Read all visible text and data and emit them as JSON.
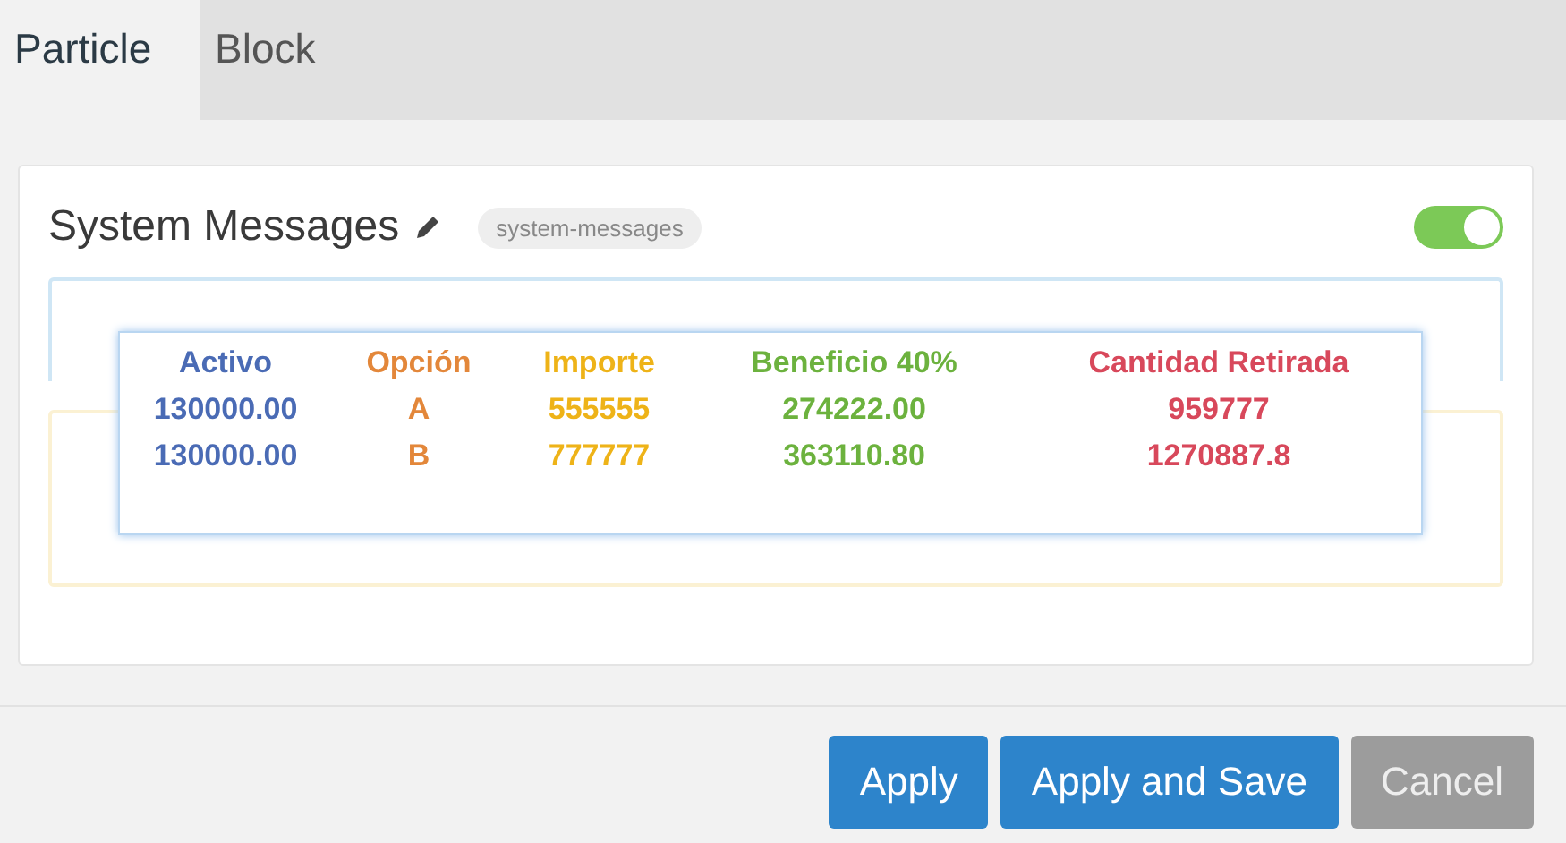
{
  "tabs": [
    {
      "label": "Particle",
      "selected": true
    },
    {
      "label": "Block",
      "selected": false
    }
  ],
  "panel": {
    "title": "System Messages",
    "tag": "system-messages",
    "enabled": {
      "on": true
    },
    "table": {
      "columns": [
        {
          "label": "Activo",
          "color": "#4a6bb5"
        },
        {
          "label": "Opción",
          "color": "#e3873a"
        },
        {
          "label": "Importe",
          "color": "#eeb318"
        },
        {
          "label": "Beneficio 40%",
          "color": "#6cb23e"
        },
        {
          "label": "Cantidad Retirada",
          "color": "#d8485b"
        }
      ],
      "rows": [
        [
          "130000.00",
          "A",
          "555555",
          "274222.00",
          "959777"
        ],
        [
          "130000.00",
          "B",
          "777777",
          "363110.80",
          "1270887.8"
        ]
      ]
    }
  },
  "buttons": [
    {
      "label": "Apply",
      "kind": "primary"
    },
    {
      "label": "Apply and Save",
      "kind": "primary"
    },
    {
      "label": "Cancel",
      "kind": "secondary"
    }
  ]
}
